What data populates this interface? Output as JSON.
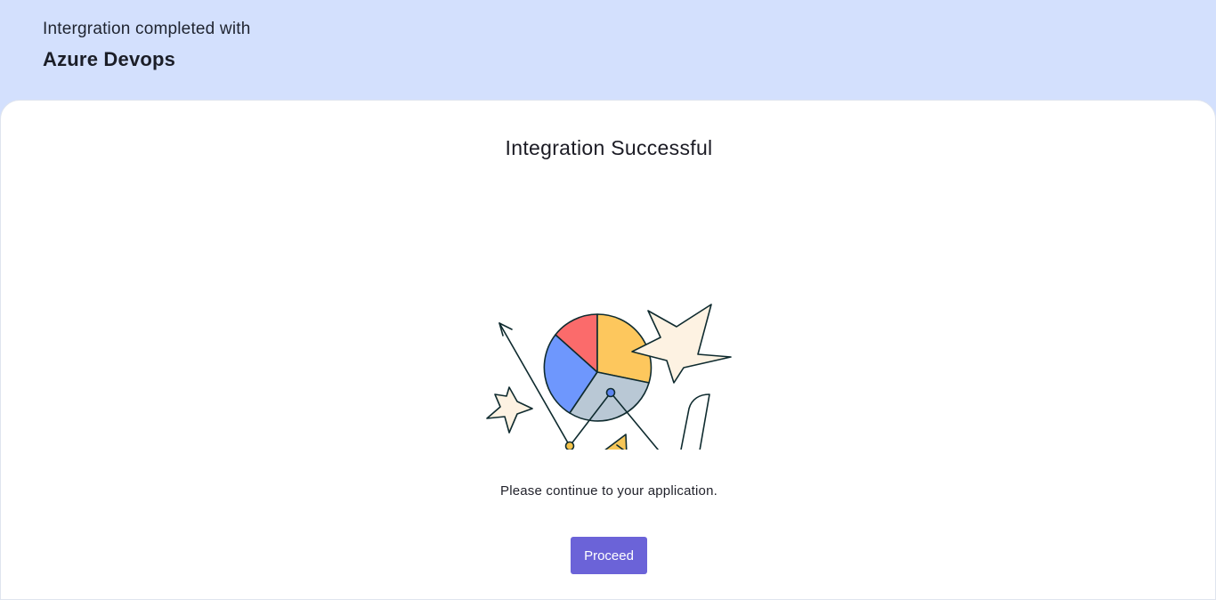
{
  "header": {
    "subtitle": "Intergration completed with",
    "title": "Azure Devops"
  },
  "card": {
    "heading": "Integration Successful",
    "message": "Please continue to your application.",
    "proceed_label": "Proceed"
  },
  "illustration": {
    "name": "integration-success-illustration",
    "colors": {
      "pie_red": "#fb6b6b",
      "pie_yellow": "#fdc75d",
      "pie_blue": "#6e97fd",
      "pie_gray": "#b9c8d5",
      "star_fill": "#fdf2e2",
      "triangle_fill": "#f6c658",
      "outline": "#0f2b2f"
    }
  },
  "colors": {
    "header_bg": "#d3e0fd",
    "card_bg": "#ffffff",
    "button_bg": "#6b63d8",
    "button_text": "#ffffff"
  }
}
